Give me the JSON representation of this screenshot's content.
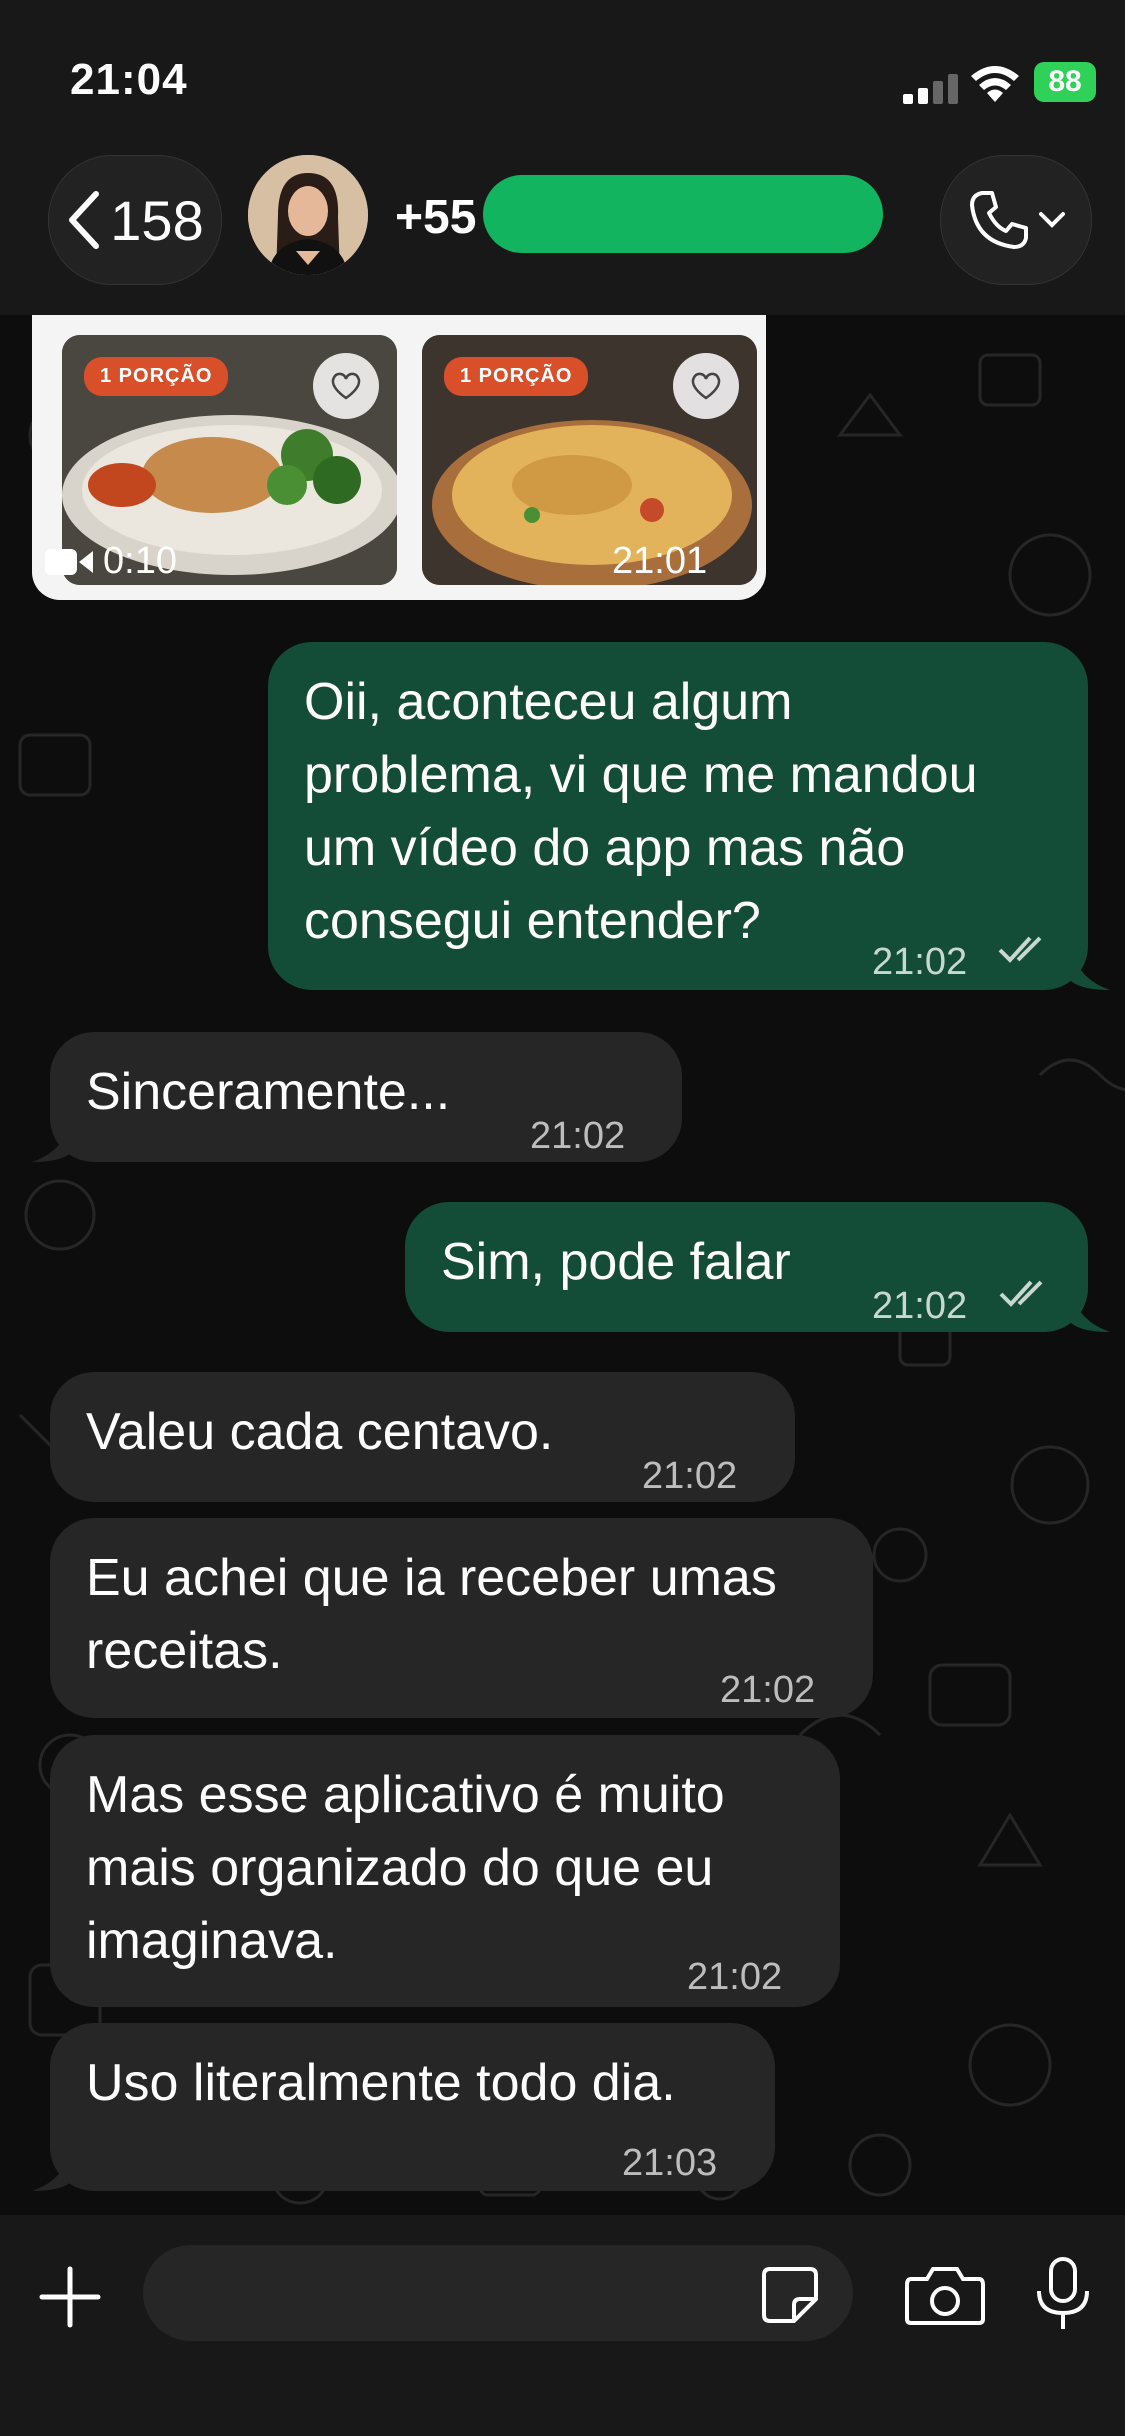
{
  "status_bar": {
    "time": "21:04",
    "battery": "88"
  },
  "header": {
    "back_count": "158",
    "contact_prefix": "+55"
  },
  "media_message": {
    "thumbnails": [
      {
        "badge": "1 PORÇÃO"
      },
      {
        "badge": "1 PORÇÃO"
      }
    ],
    "video_duration": "0:10",
    "time": "21:01"
  },
  "messages": [
    {
      "direction": "out",
      "text": "Oii, aconteceu algum\nproblema, vi que me mandou\num vídeo do app mas não\nconsegui entender?",
      "time": "21:02",
      "read": true
    },
    {
      "direction": "in",
      "text": "Sinceramente...",
      "time": "21:02"
    },
    {
      "direction": "out",
      "text": "Sim, pode falar",
      "time": "21:02",
      "read": true
    },
    {
      "direction": "in",
      "text": "Valeu cada centavo.",
      "time": "21:02"
    },
    {
      "direction": "in",
      "text": "Eu achei que ia receber umas\nreceitas.",
      "time": "21:02"
    },
    {
      "direction": "in",
      "text": "Mas esse aplicativo é muito\nmais organizado do que eu\nimaginava.",
      "time": "21:02"
    },
    {
      "direction": "in",
      "text": "Uso literalmente todo dia.",
      "time": "21:03"
    }
  ],
  "colors": {
    "incoming_bubble": "#262626",
    "outgoing_bubble": "#144d37",
    "redaction": "#13b45f",
    "badge": "#d94f2a"
  },
  "icons": [
    "back-chevron-icon",
    "phone-icon",
    "chevron-down-icon",
    "heart-icon",
    "video-camera-icon",
    "double-check-icon",
    "plus-icon",
    "sticker-icon",
    "camera-icon",
    "microphone-icon",
    "signal-icon",
    "wifi-icon"
  ]
}
